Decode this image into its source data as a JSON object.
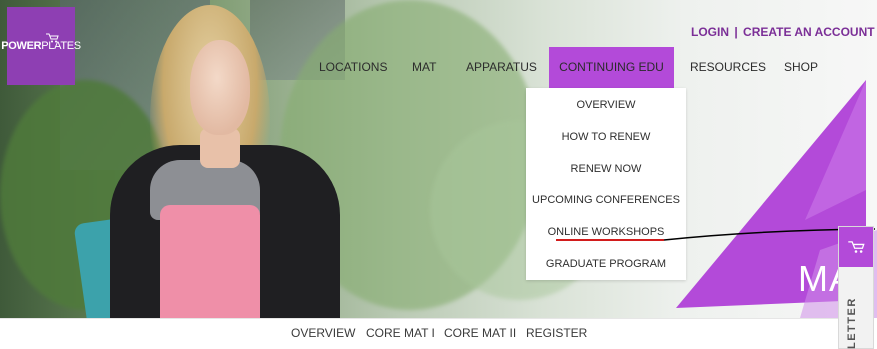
{
  "brand": {
    "logo_text_bold": "POWER",
    "logo_text_light": "PLATES",
    "logo_icon": "stroller-icon",
    "color_primary": "#b34ad9",
    "color_dark": "#7b2f97"
  },
  "auth": {
    "login_label": "LOGIN",
    "separator": "|",
    "create_account_label": "CREATE AN ACCOUNT"
  },
  "nav": {
    "items": [
      {
        "label": "LOCATIONS",
        "active": false
      },
      {
        "label": "MAT",
        "active": false
      },
      {
        "label": "APPARATUS",
        "active": false
      },
      {
        "label": "CONTINUING  EDU",
        "active": true
      },
      {
        "label": "RESOURCES",
        "active": false
      },
      {
        "label": "SHOP",
        "active": false
      }
    ]
  },
  "dropdown": {
    "items": [
      {
        "label": "OVERVIEW"
      },
      {
        "label": "HOW TO RENEW"
      },
      {
        "label": "RENEW NOW"
      },
      {
        "label": "UPCOMING CONFERENCES"
      },
      {
        "label": "ONLINE WORKSHOPS",
        "highlighted": true
      },
      {
        "label": "GRADUATE PROGRAM"
      }
    ]
  },
  "hero": {
    "overlay_text": "MA"
  },
  "newsletter": {
    "label": "LETTER",
    "icon": "stroller-icon"
  },
  "subnav": {
    "items": [
      {
        "label": "OVERVIEW"
      },
      {
        "label": "CORE MAT I"
      },
      {
        "label": "CORE MAT II"
      },
      {
        "label": "REGISTER"
      }
    ]
  }
}
